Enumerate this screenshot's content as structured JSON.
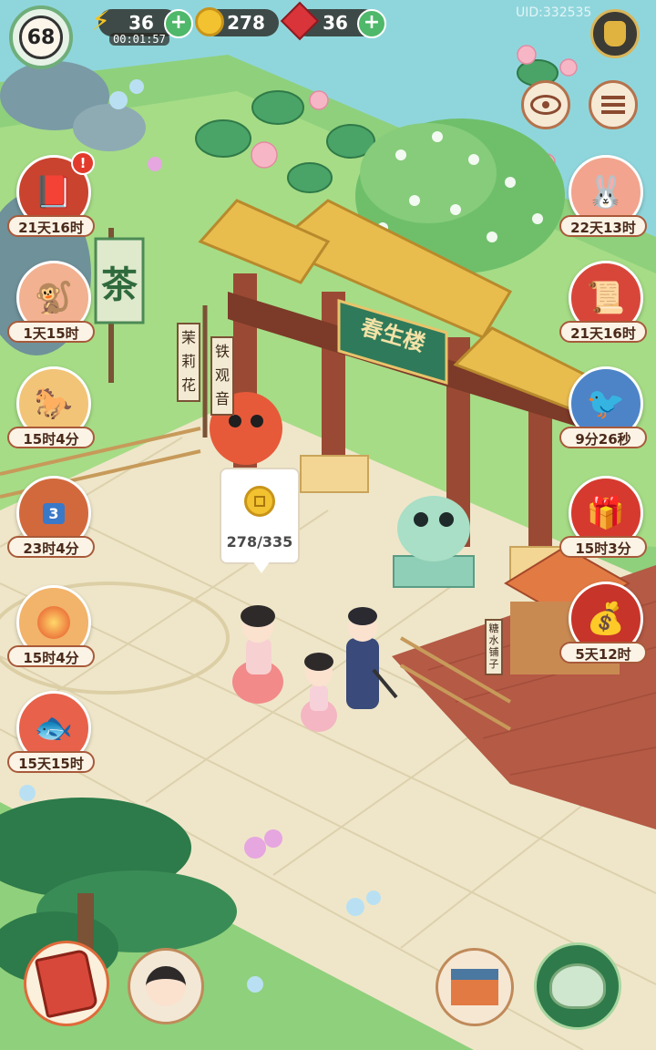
{
  "player": {
    "level": "68"
  },
  "resources": {
    "energy": {
      "value": "36",
      "timer": "00:01:57",
      "icon": "lightning-icon"
    },
    "coins": {
      "value": "278",
      "icon": "coin-icon"
    },
    "gems": {
      "value": "36",
      "icon": "ruby-icon"
    }
  },
  "uid": "UID:332535",
  "scene": {
    "gate_sign": "春生楼",
    "tea_flag": "茶",
    "sign_post_left": [
      "茉",
      "莉",
      "花"
    ],
    "sign_post_right": [
      "铁",
      "观",
      "音"
    ],
    "stall_sign": "糖水铺子",
    "coin_bubble": {
      "progress": "278/335",
      "icon": "coin-icon"
    }
  },
  "left_events": [
    {
      "name": "event-ledger",
      "timer": "21天16时",
      "icon": "book-icon",
      "alert": true
    },
    {
      "name": "event-monkey",
      "timer": "1天15时",
      "icon": "monkey-icon"
    },
    {
      "name": "event-horse",
      "timer": "15时4分",
      "icon": "horse-icon"
    },
    {
      "name": "event-chest",
      "timer": "23时4分",
      "icon": "chest-icon",
      "count": "3"
    },
    {
      "name": "event-orb",
      "timer": "15时4分",
      "icon": "fire-orb-icon"
    },
    {
      "name": "event-carp",
      "timer": "15天15时",
      "icon": "carp-icon"
    }
  ],
  "right_events": [
    {
      "name": "event-rabbit",
      "timer": "22天13时",
      "icon": "rabbit-icon"
    },
    {
      "name": "event-scroll",
      "timer": "21天16时",
      "icon": "scroll-icon"
    },
    {
      "name": "event-swallow",
      "timer": "9分26秒",
      "icon": "swallow-icon"
    },
    {
      "name": "event-giftbox",
      "timer": "15时3分",
      "icon": "giftbox-icon"
    },
    {
      "name": "event-treasure",
      "timer": "5天12时",
      "icon": "treasure-icon"
    }
  ],
  "colors": {
    "water": "#8fd6dc",
    "grass": "#8fd07c",
    "stone": "#efe6c9",
    "brick": "#b45a45",
    "roof": "#e9bc4e",
    "pillar": "#9a4a34"
  }
}
